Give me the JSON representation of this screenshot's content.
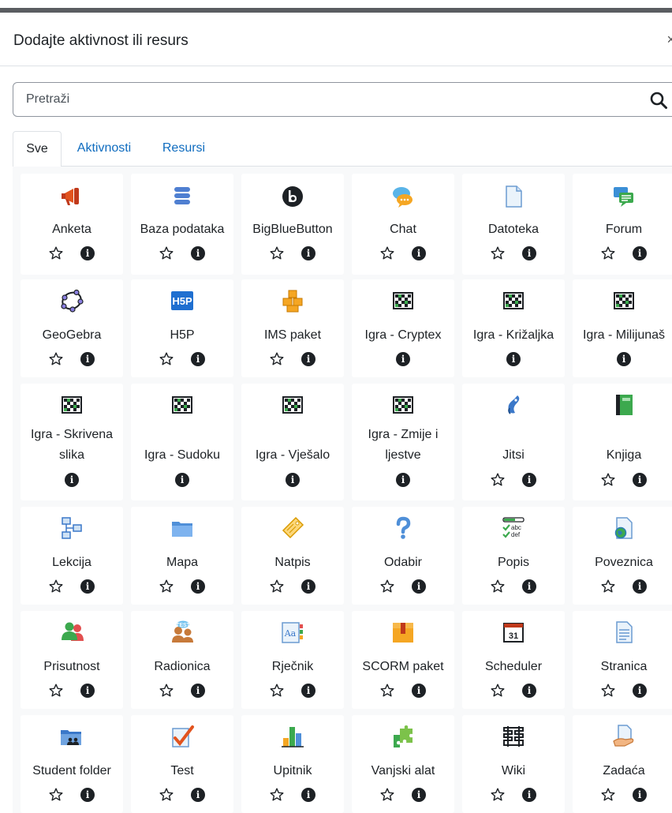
{
  "dialog": {
    "title": "Dodajte aktivnost ili resurs",
    "close_glyph": "×"
  },
  "search": {
    "placeholder": "Pretraži"
  },
  "tabs": [
    "Sve",
    "Aktivnosti",
    "Resursi"
  ],
  "active_tab": "Sve",
  "colors": {
    "link": "#0f6cbf",
    "text": "#1d2125",
    "background": "#f8f9fa",
    "border": "#dee2e6"
  },
  "items": [
    {
      "name": "Anketa",
      "icon": "megaphone-icon",
      "starrable": true
    },
    {
      "name": "Baza podataka",
      "icon": "database-icon",
      "starrable": true
    },
    {
      "name": "BigBlueButton",
      "icon": "bigbluebutton-icon",
      "starrable": true
    },
    {
      "name": "Chat",
      "icon": "chat-icon",
      "starrable": true
    },
    {
      "name": "Datoteka",
      "icon": "file-icon",
      "starrable": true
    },
    {
      "name": "Forum",
      "icon": "forum-icon",
      "starrable": true
    },
    {
      "name": "GeoGebra",
      "icon": "geogebra-icon",
      "starrable": true
    },
    {
      "name": "H5P",
      "icon": "h5p-icon",
      "starrable": true
    },
    {
      "name": "IMS paket",
      "icon": "ims-package-icon",
      "starrable": true
    },
    {
      "name": "Igra - Cryptex",
      "icon": "game-icon",
      "starrable": false
    },
    {
      "name": "Igra - Križaljka",
      "icon": "game-icon",
      "starrable": false
    },
    {
      "name": "Igra - Milijunaš",
      "icon": "game-icon",
      "starrable": false
    },
    {
      "name": "Igra - Skrivena slika",
      "icon": "game-icon",
      "starrable": false
    },
    {
      "name": "Igra - Sudoku",
      "icon": "game-icon",
      "starrable": false
    },
    {
      "name": "Igra - Vješalo",
      "icon": "game-icon",
      "starrable": false
    },
    {
      "name": "Igra - Zmije i ljestve",
      "icon": "game-icon",
      "starrable": false
    },
    {
      "name": "Jitsi",
      "icon": "jitsi-icon",
      "starrable": true
    },
    {
      "name": "Knjiga",
      "icon": "book-icon",
      "starrable": true
    },
    {
      "name": "Lekcija",
      "icon": "lesson-icon",
      "starrable": true
    },
    {
      "name": "Mapa",
      "icon": "folder-icon",
      "starrable": true
    },
    {
      "name": "Natpis",
      "icon": "label-icon",
      "starrable": true
    },
    {
      "name": "Odabir",
      "icon": "choice-icon",
      "starrable": true
    },
    {
      "name": "Popis",
      "icon": "checklist-icon",
      "starrable": true
    },
    {
      "name": "Poveznica",
      "icon": "url-icon",
      "starrable": true
    },
    {
      "name": "Prisutnost",
      "icon": "attendance-icon",
      "starrable": true
    },
    {
      "name": "Radionica",
      "icon": "workshop-icon",
      "starrable": true
    },
    {
      "name": "Rječnik",
      "icon": "glossary-icon",
      "starrable": true
    },
    {
      "name": "SCORM paket",
      "icon": "scorm-icon",
      "starrable": true
    },
    {
      "name": "Scheduler",
      "icon": "calendar-icon",
      "starrable": true
    },
    {
      "name": "Stranica",
      "icon": "page-icon",
      "starrable": true
    },
    {
      "name": "Student folder",
      "icon": "student-folder-icon",
      "starrable": true
    },
    {
      "name": "Test",
      "icon": "quiz-icon",
      "starrable": true
    },
    {
      "name": "Upitnik",
      "icon": "questionnaire-icon",
      "starrable": true
    },
    {
      "name": "Vanjski alat",
      "icon": "puzzle-icon",
      "starrable": true
    },
    {
      "name": "Wiki",
      "icon": "wiki-icon",
      "starrable": true
    },
    {
      "name": "Zadaća",
      "icon": "assignment-icon",
      "starrable": true
    }
  ]
}
